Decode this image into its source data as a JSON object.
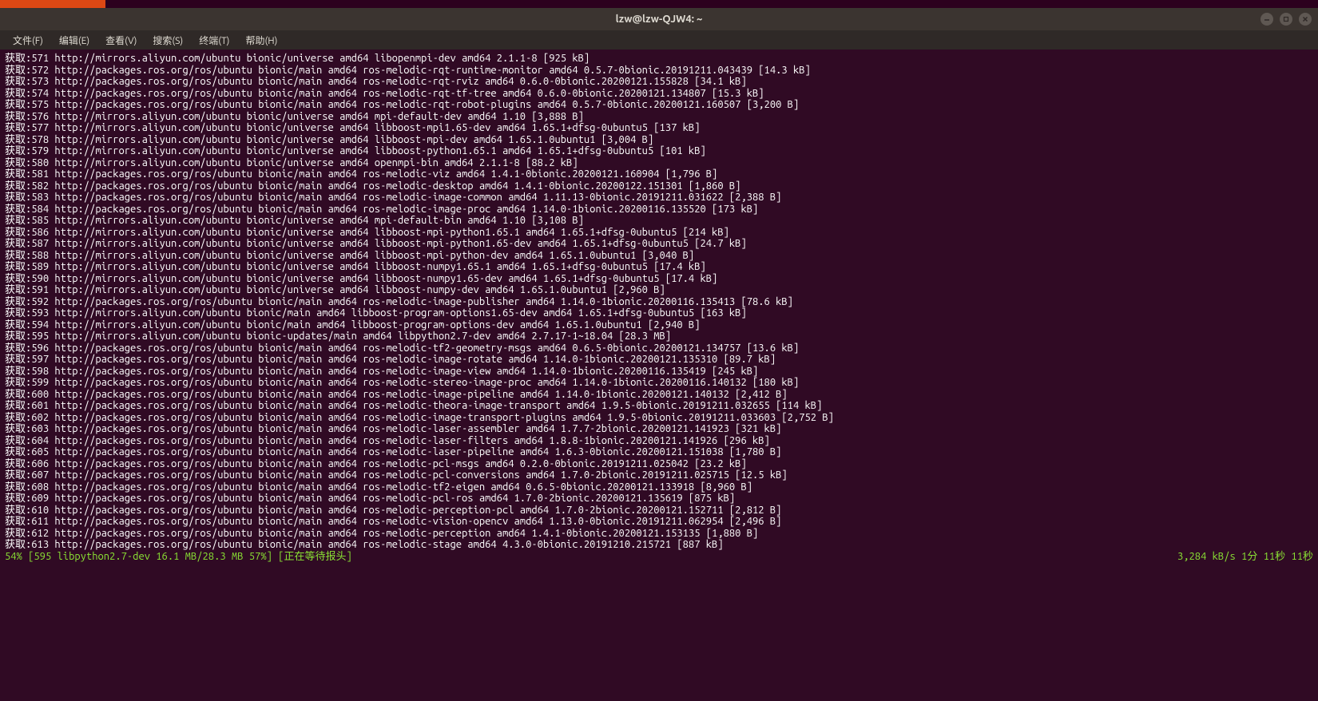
{
  "titlebar": {
    "title": "lzw@lzw-QJW4: ~"
  },
  "menubar": {
    "items": [
      "文件(F)",
      "编辑(E)",
      "查看(V)",
      "搜索(S)",
      "终端(T)",
      "帮助(H)"
    ]
  },
  "terminal": {
    "lines": [
      "获取:571 http://mirrors.aliyun.com/ubuntu bionic/universe amd64 libopenmpi-dev amd64 2.1.1-8 [925 kB]",
      "获取:572 http://packages.ros.org/ros/ubuntu bionic/main amd64 ros-melodic-rqt-runtime-monitor amd64 0.5.7-0bionic.20191211.043439 [14.3 kB]",
      "获取:573 http://packages.ros.org/ros/ubuntu bionic/main amd64 ros-melodic-rqt-rviz amd64 0.6.0-0bionic.20200121.155828 [34.1 kB]",
      "获取:574 http://packages.ros.org/ros/ubuntu bionic/main amd64 ros-melodic-rqt-tf-tree amd64 0.6.0-0bionic.20200121.134807 [15.3 kB]",
      "获取:575 http://packages.ros.org/ros/ubuntu bionic/main amd64 ros-melodic-rqt-robot-plugins amd64 0.5.7-0bionic.20200121.160507 [3,200 B]",
      "获取:576 http://mirrors.aliyun.com/ubuntu bionic/universe amd64 mpi-default-dev amd64 1.10 [3,888 B]",
      "获取:577 http://mirrors.aliyun.com/ubuntu bionic/universe amd64 libboost-mpi1.65-dev amd64 1.65.1+dfsg-0ubuntu5 [137 kB]",
      "获取:578 http://mirrors.aliyun.com/ubuntu bionic/universe amd64 libboost-mpi-dev amd64 1.65.1.0ubuntu1 [3,004 B]",
      "获取:579 http://mirrors.aliyun.com/ubuntu bionic/universe amd64 libboost-python1.65.1 amd64 1.65.1+dfsg-0ubuntu5 [101 kB]",
      "获取:580 http://mirrors.aliyun.com/ubuntu bionic/universe amd64 openmpi-bin amd64 2.1.1-8 [88.2 kB]",
      "获取:581 http://packages.ros.org/ros/ubuntu bionic/main amd64 ros-melodic-viz amd64 1.4.1-0bionic.20200121.160904 [1,796 B]",
      "获取:582 http://packages.ros.org/ros/ubuntu bionic/main amd64 ros-melodic-desktop amd64 1.4.1-0bionic.20200122.151301 [1,860 B]",
      "获取:583 http://packages.ros.org/ros/ubuntu bionic/main amd64 ros-melodic-image-common amd64 1.11.13-0bionic.20191211.031622 [2,388 B]",
      "获取:584 http://packages.ros.org/ros/ubuntu bionic/main amd64 ros-melodic-image-proc amd64 1.14.0-1bionic.20200116.135520 [173 kB]",
      "获取:585 http://mirrors.aliyun.com/ubuntu bionic/universe amd64 mpi-default-bin amd64 1.10 [3,108 B]",
      "获取:586 http://mirrors.aliyun.com/ubuntu bionic/universe amd64 libboost-mpi-python1.65.1 amd64 1.65.1+dfsg-0ubuntu5 [214 kB]",
      "获取:587 http://mirrors.aliyun.com/ubuntu bionic/universe amd64 libboost-mpi-python1.65-dev amd64 1.65.1+dfsg-0ubuntu5 [24.7 kB]",
      "获取:588 http://mirrors.aliyun.com/ubuntu bionic/universe amd64 libboost-mpi-python-dev amd64 1.65.1.0ubuntu1 [3,040 B]",
      "获取:589 http://mirrors.aliyun.com/ubuntu bionic/universe amd64 libboost-numpy1.65.1 amd64 1.65.1+dfsg-0ubuntu5 [17.4 kB]",
      "获取:590 http://mirrors.aliyun.com/ubuntu bionic/universe amd64 libboost-numpy1.65-dev amd64 1.65.1+dfsg-0ubuntu5 [17.4 kB]",
      "获取:591 http://mirrors.aliyun.com/ubuntu bionic/universe amd64 libboost-numpy-dev amd64 1.65.1.0ubuntu1 [2,960 B]",
      "获取:592 http://packages.ros.org/ros/ubuntu bionic/main amd64 ros-melodic-image-publisher amd64 1.14.0-1bionic.20200116.135413 [78.6 kB]",
      "获取:593 http://mirrors.aliyun.com/ubuntu bionic/main amd64 libboost-program-options1.65-dev amd64 1.65.1+dfsg-0ubuntu5 [163 kB]",
      "获取:594 http://mirrors.aliyun.com/ubuntu bionic/main amd64 libboost-program-options-dev amd64 1.65.1.0ubuntu1 [2,940 B]",
      "获取:595 http://mirrors.aliyun.com/ubuntu bionic-updates/main amd64 libpython2.7-dev amd64 2.7.17-1~18.04 [28.3 MB]",
      "获取:596 http://packages.ros.org/ros/ubuntu bionic/main amd64 ros-melodic-tf2-geometry-msgs amd64 0.6.5-0bionic.20200121.134757 [13.6 kB]",
      "获取:597 http://packages.ros.org/ros/ubuntu bionic/main amd64 ros-melodic-image-rotate amd64 1.14.0-1bionic.20200121.135310 [89.7 kB]",
      "获取:598 http://packages.ros.org/ros/ubuntu bionic/main amd64 ros-melodic-image-view amd64 1.14.0-1bionic.20200116.135419 [245 kB]",
      "获取:599 http://packages.ros.org/ros/ubuntu bionic/main amd64 ros-melodic-stereo-image-proc amd64 1.14.0-1bionic.20200116.140132 [180 kB]",
      "获取:600 http://packages.ros.org/ros/ubuntu bionic/main amd64 ros-melodic-image-pipeline amd64 1.14.0-1bionic.20200121.140132 [2,412 B]",
      "获取:601 http://packages.ros.org/ros/ubuntu bionic/main amd64 ros-melodic-theora-image-transport amd64 1.9.5-0bionic.20191211.032655 [114 kB]",
      "获取:602 http://packages.ros.org/ros/ubuntu bionic/main amd64 ros-melodic-image-transport-plugins amd64 1.9.5-0bionic.20191211.033603 [2,752 B]",
      "获取:603 http://packages.ros.org/ros/ubuntu bionic/main amd64 ros-melodic-laser-assembler amd64 1.7.7-2bionic.20200121.141923 [321 kB]",
      "获取:604 http://packages.ros.org/ros/ubuntu bionic/main amd64 ros-melodic-laser-filters amd64 1.8.8-1bionic.20200121.141926 [296 kB]",
      "获取:605 http://packages.ros.org/ros/ubuntu bionic/main amd64 ros-melodic-laser-pipeline amd64 1.6.3-0bionic.20200121.151038 [1,780 B]",
      "获取:606 http://packages.ros.org/ros/ubuntu bionic/main amd64 ros-melodic-pcl-msgs amd64 0.2.0-0bionic.20191211.025042 [23.2 kB]",
      "获取:607 http://packages.ros.org/ros/ubuntu bionic/main amd64 ros-melodic-pcl-conversions amd64 1.7.0-2bionic.20191211.025715 [12.5 kB]",
      "获取:608 http://packages.ros.org/ros/ubuntu bionic/main amd64 ros-melodic-tf2-eigen amd64 0.6.5-0bionic.20200121.133918 [8,960 B]",
      "获取:609 http://packages.ros.org/ros/ubuntu bionic/main amd64 ros-melodic-pcl-ros amd64 1.7.0-2bionic.20200121.135619 [875 kB]",
      "获取:610 http://packages.ros.org/ros/ubuntu bionic/main amd64 ros-melodic-perception-pcl amd64 1.7.0-2bionic.20200121.152711 [2,812 B]",
      "获取:611 http://packages.ros.org/ros/ubuntu bionic/main amd64 ros-melodic-vision-opencv amd64 1.13.0-0bionic.20191211.062954 [2,496 B]",
      "获取:612 http://packages.ros.org/ros/ubuntu bionic/main amd64 ros-melodic-perception amd64 1.4.1-0bionic.20200121.153135 [1,880 B]",
      "获取:613 http://packages.ros.org/ros/ubuntu bionic/main amd64 ros-melodic-stage amd64 4.3.0-0bionic.20191210.215721 [887 kB]"
    ],
    "progress_left": "54% [595 libpython2.7-dev 16.1 MB/28.3 MB 57%] [正在等待报头]",
    "progress_right": "3,284 kB/s 1分 11秒 11秒"
  }
}
